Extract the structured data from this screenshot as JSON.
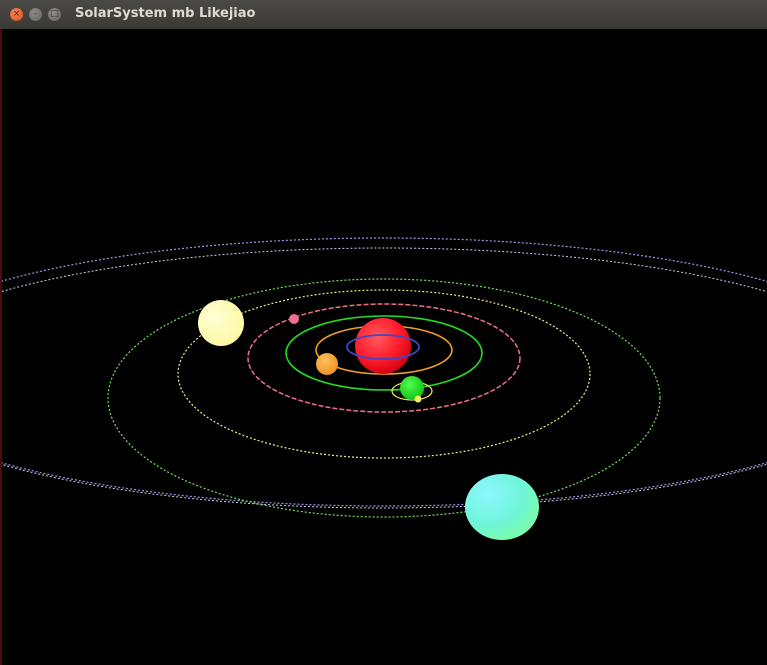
{
  "window": {
    "title": "SolarSystem mb Likejiao",
    "buttons": {
      "close": "×",
      "minimize": "–",
      "maximize": "□"
    }
  },
  "scene": {
    "background": "#000000",
    "sun_color": "#ff1a2a",
    "orbit_colors": {
      "inner_blue": "#3a48c8",
      "orange": "#f2a021",
      "green": "#22dd22",
      "pink": "#ee6f8a",
      "yellow_dotted": "#f0ef88",
      "green_dotted": "#78dd60",
      "outer_lilac": "#9a9ae8",
      "outer_pale": "#cfcfef"
    },
    "planet_colors": {
      "orange_planet": "#ffa53a",
      "pink_planet": "#f07090",
      "green_planet": "#20e020",
      "moon": "#f6f060",
      "pale_yellow_planet": "#fffcb0",
      "cyan_planet": "#7affe0"
    }
  }
}
